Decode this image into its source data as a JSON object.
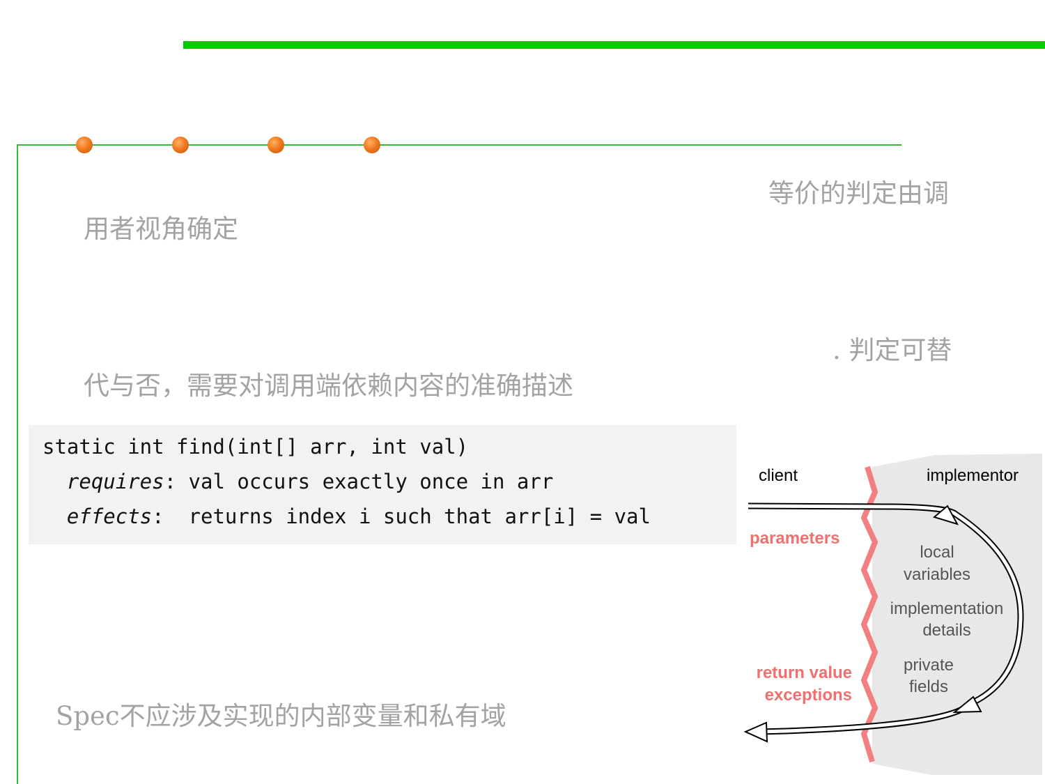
{
  "text": {
    "line1_right": "等价的判定由调",
    "line1_left": "用者视角确定",
    "line2_right": ". 判定可替",
    "line2_left": "代与否，需要对调用端依赖内容的准确描述",
    "bottom": "Spec不应涉及实现的内部变量和私有域"
  },
  "code": {
    "sig": "static int find(int[] arr, int val)",
    "req_kw": "requires",
    "req_rest": ": val occurs exactly once in arr",
    "eff_kw": "effects",
    "eff_rest": ":  returns index i such that arr[i] = val"
  },
  "diagram": {
    "client": "client",
    "implementor": "implementor",
    "parameters": "parameters",
    "return_value": "return value",
    "exceptions": "exceptions",
    "local": "local",
    "variables": "variables",
    "implementation": "implementation",
    "details": "details",
    "private": "private",
    "fields": "fields"
  },
  "colors": {
    "accent_green": "#00cc00",
    "dot_orange": "#f07a1f",
    "boundary_red": "#f28080",
    "label_red": "#f07070"
  }
}
